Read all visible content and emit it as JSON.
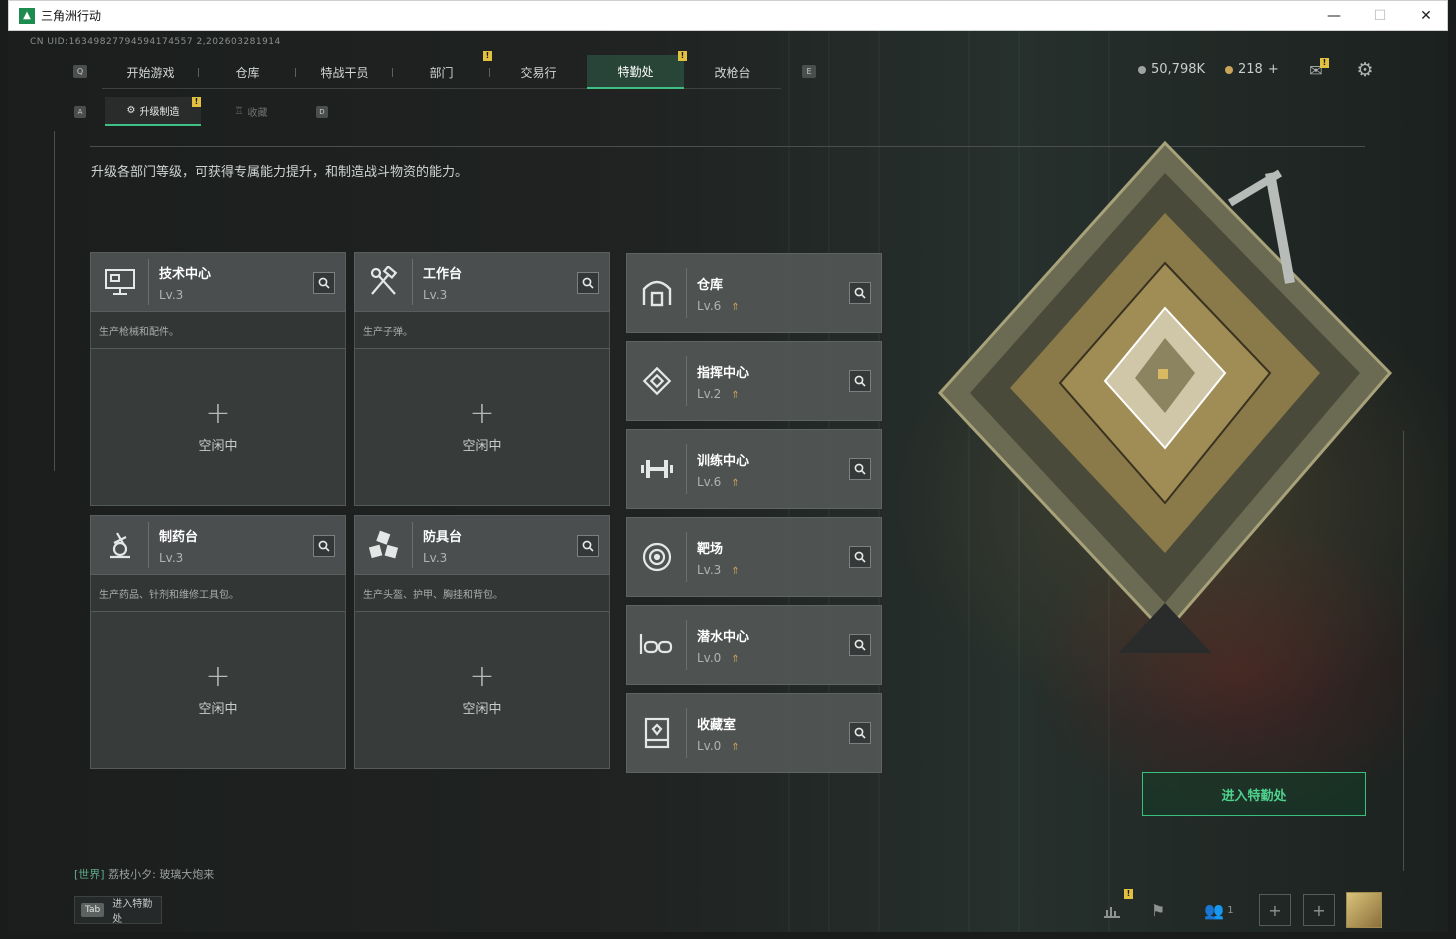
{
  "window": {
    "title": "三角洲行动",
    "minimize": "—",
    "maximize": "☐",
    "close": "✕"
  },
  "uid": "CN UID:16349827794594174557 2,202603281914",
  "nav": {
    "key_left": "Q",
    "key_right": "E",
    "items": [
      "开始游戏",
      "仓库",
      "特战干员",
      "部门",
      "交易行",
      "特勤处",
      "改枪台"
    ],
    "active": "特勤处"
  },
  "currency": {
    "coins": "50,798K",
    "coupons": "218",
    "plus": "+"
  },
  "subtabs": {
    "key_left": "A",
    "key_right": "D",
    "upgrade": "升级制造",
    "collection": "收藏"
  },
  "description": "升级各部门等级，可获得专属能力提升，和制造战斗物资的能力。",
  "production_cards": [
    {
      "name": "技术中心",
      "level": "Lv.3",
      "desc": "生产枪械和配件。",
      "status": "空闲中",
      "icon": "computer-icon"
    },
    {
      "name": "工作台",
      "level": "Lv.3",
      "desc": "生产子弹。",
      "status": "空闲中",
      "icon": "tools-icon"
    },
    {
      "name": "制药台",
      "level": "Lv.3",
      "desc": "生产药品、针剂和维修工具包。",
      "status": "空闲中",
      "icon": "microscope-icon"
    },
    {
      "name": "防具台",
      "level": "Lv.3",
      "desc": "生产头盔、护甲、胸挂和背包。",
      "status": "空闲中",
      "icon": "armor-icon"
    }
  ],
  "facilities": [
    {
      "name": "仓库",
      "level": "Lv.6",
      "icon": "warehouse-icon"
    },
    {
      "name": "指挥中心",
      "level": "Lv.2",
      "icon": "command-icon"
    },
    {
      "name": "训练中心",
      "level": "Lv.6",
      "icon": "dumbbell-icon"
    },
    {
      "name": "靶场",
      "level": "Lv.3",
      "icon": "target-icon"
    },
    {
      "name": "潜水中心",
      "level": "Lv.0",
      "icon": "goggles-icon"
    },
    {
      "name": "收藏室",
      "level": "Lv.0",
      "icon": "display-case-icon"
    }
  ],
  "enter_button": "进入特勤处",
  "chat": {
    "channel": "[世界]",
    "user": "荔枝小夕:",
    "message": "玻璃大炮来"
  },
  "tab_hint": {
    "key": "Tab",
    "label": "进入特勤处"
  },
  "friends_count": "1",
  "colors": {
    "accent": "#3fbf84",
    "badge": "#e2c040",
    "lvup": "#c9a45a"
  }
}
